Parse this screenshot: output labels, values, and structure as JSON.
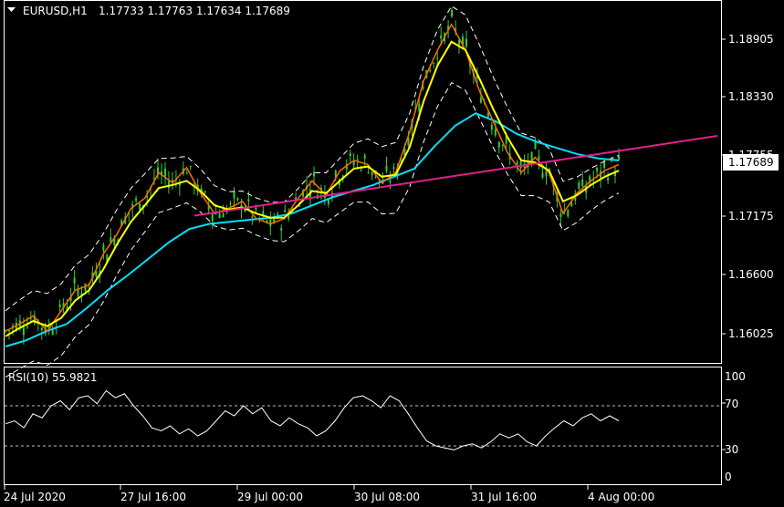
{
  "header": {
    "symbol": "EURUSD,H1",
    "ohlc": "1.17733 1.17763 1.17634 1.17689"
  },
  "price_panel": {
    "price_ticks": [
      "1.18905",
      "1.18330",
      "1.17755",
      "1.17175",
      "1.16600",
      "1.16025"
    ],
    "current_price": "1.17689"
  },
  "rsi_panel": {
    "label": "RSI(10) 55.9821",
    "levels": [
      "100",
      "70",
      "30",
      "0"
    ]
  },
  "time_axis": {
    "labels": [
      "24 Jul 2020",
      "27 Jul 16:00",
      "29 Jul 00:00",
      "30 Jul 08:00",
      "31 Jul 16:00",
      "4 Aug 00:00"
    ]
  },
  "colors": {
    "background": "#000000",
    "candle": "#32cd32",
    "ma_fast": "#ff6a00",
    "ma_mid": "#ffff00",
    "ma_slow": "#00e0ff",
    "bands": "#ffffff",
    "trendline": "#e0208a",
    "rsi_line": "#ffffff",
    "price_badge": "#ffffff"
  },
  "chart_data": [
    {
      "type": "line",
      "title": "EURUSD,H1",
      "ylim": [
        1.1565,
        1.193
      ],
      "x_labels": [
        "24 Jul 2020",
        "27 Jul 16:00",
        "29 Jul 00:00",
        "30 Jul 08:00",
        "31 Jul 16:00",
        "4 Aug 00:00"
      ],
      "last_price": 1.17689,
      "series": [
        {
          "values": [
            1.1605,
            1.1612,
            1.162,
            1.1605,
            1.1625,
            1.1645,
            1.165,
            1.168,
            1.17,
            1.1725,
            1.1735,
            1.176,
            1.175,
            1.1765,
            1.174,
            1.172,
            1.1725,
            1.1732,
            1.1715,
            1.171,
            1.1715,
            1.1735,
            1.1752,
            1.1738,
            1.1762,
            1.1772,
            1.1768,
            1.175,
            1.176,
            1.18,
            1.185,
            1.188,
            1.1905,
            1.188,
            1.184,
            1.181,
            1.178,
            1.176,
            1.1775,
            1.176,
            1.172,
            1.174,
            1.1752,
            1.1762,
            1.1768
          ]
        },
        {
          "values": [
            1.16,
            1.1608,
            1.1615,
            1.161,
            1.1618,
            1.1635,
            1.1645,
            1.1665,
            1.169,
            1.1712,
            1.1728,
            1.1745,
            1.1748,
            1.1752,
            1.1742,
            1.1728,
            1.1724,
            1.1726,
            1.172,
            1.1716,
            1.1716,
            1.1728,
            1.1742,
            1.174,
            1.1752,
            1.1764,
            1.1766,
            1.1756,
            1.1758,
            1.1785,
            1.183,
            1.1865,
            1.1888,
            1.188,
            1.1852,
            1.1822,
            1.1795,
            1.1772,
            1.177,
            1.1762,
            1.1732,
            1.1738,
            1.1748,
            1.1756,
            1.1762
          ]
        },
        {
          "values": [
            1.159,
            1.1596,
            1.1605,
            1.1612,
            1.1628,
            1.1645,
            1.166,
            1.1676,
            1.1692,
            1.1705,
            1.171,
            1.1712,
            1.1714,
            1.1716,
            1.172,
            1.1728,
            1.1736,
            1.1742,
            1.1748,
            1.1756,
            1.1764,
            1.1786,
            1.1806,
            1.1818,
            1.181,
            1.1798,
            1.179,
            1.1784,
            1.1778,
            1.1774,
            1.1772
          ]
        },
        {
          "name": "trendline",
          "values": [
            1.1718,
            1.1796
          ]
        }
      ]
    },
    {
      "type": "line",
      "title": "RSI(10) 55.9821",
      "ylim": [
        0,
        100
      ],
      "levels": [
        70,
        30
      ],
      "series": [
        {
          "name": "RSI(10)",
          "values": [
            52,
            55,
            48,
            62,
            58,
            70,
            75,
            66,
            78,
            80,
            72,
            85,
            78,
            82,
            70,
            60,
            48,
            45,
            50,
            42,
            47,
            40,
            45,
            55,
            65,
            60,
            70,
            62,
            68,
            55,
            50,
            58,
            52,
            48,
            40,
            45,
            55,
            68,
            78,
            80,
            75,
            68,
            80,
            75,
            62,
            48,
            35,
            30,
            28,
            26,
            30,
            32,
            28,
            34,
            42,
            38,
            42,
            34,
            30,
            40,
            48,
            55,
            50,
            58,
            62,
            55,
            60,
            55
          ]
        }
      ]
    }
  ]
}
